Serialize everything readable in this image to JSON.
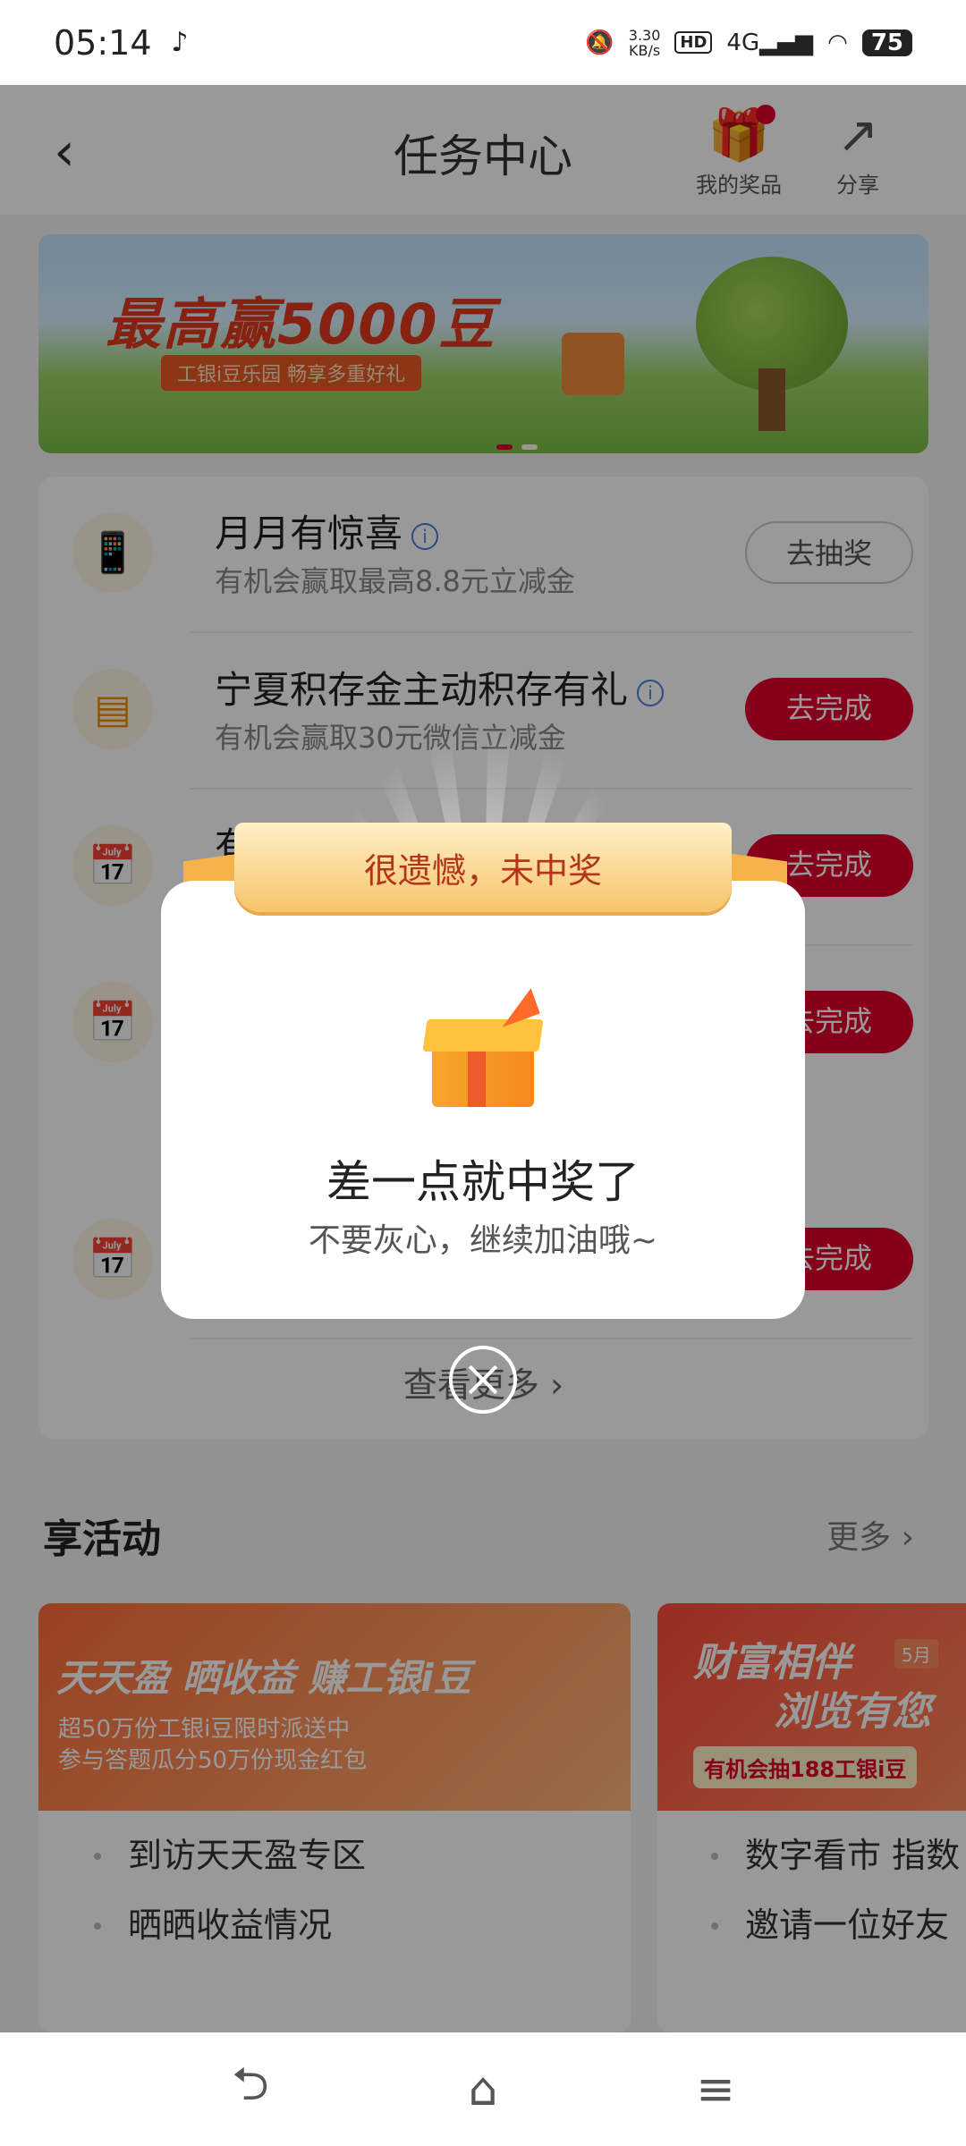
{
  "status_bar": {
    "time": "05:14",
    "speed_value": "3.30",
    "speed_unit": "KB/s",
    "hd": "HD",
    "network": "4G",
    "battery": "75"
  },
  "header": {
    "title": "任务中心",
    "prizes_label": "我的奖品",
    "share_label": "分享"
  },
  "banner": {
    "headline": "最高赢5000豆",
    "tagline": "工银i豆乐园 畅享多重好礼"
  },
  "tasks": [
    {
      "name": "月月有惊喜",
      "desc": "有机会赢取最高8.8元立减金",
      "button": "去抽奖"
    },
    {
      "name": "宁夏积存金主动积存有礼",
      "desc": "有机会赢取30元微信立减金",
      "button": "去完成"
    },
    {
      "name": "有",
      "desc": "",
      "button": "去完成"
    },
    {
      "name": "",
      "desc": "",
      "button": "去完成"
    },
    {
      "name": "",
      "desc": "",
      "button": "去完成"
    }
  ],
  "view_more": "查看更多",
  "activities": {
    "title": "享活动",
    "more": "更多",
    "card1": {
      "headline": "天天盈 晒收益 赚工银i豆",
      "sub1": "超50万份工银i豆限时派送中",
      "sub2": "参与答题瓜分50万份现金红包",
      "items": [
        "到访天天盈专区",
        "晒晒收益情况"
      ]
    },
    "card2": {
      "headline1": "财富相伴",
      "headline2": "浏览有您",
      "badge": "5月",
      "strip": "有机会抽188工银i豆",
      "items": [
        "数字看市 指数",
        "邀请一位好友"
      ]
    }
  },
  "modal": {
    "ribbon": "很遗憾，未中奖",
    "title": "差一点就中奖了",
    "subtitle": "不要灰心，继续加油哦~"
  }
}
